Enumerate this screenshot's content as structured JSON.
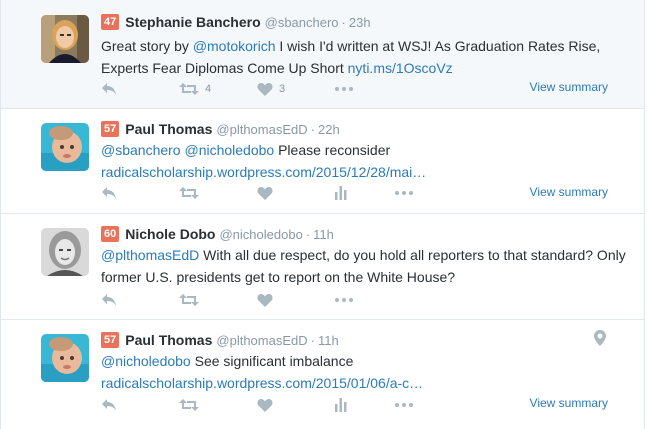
{
  "colors": {
    "link": "#2b7bb9",
    "score": "#e8735a",
    "muted": "#8899a6",
    "icon": "#aab8c2"
  },
  "tweets": [
    {
      "score": "47",
      "name": "Stephanie Banchero",
      "handle": "@sbanchero",
      "sep": "·",
      "time": "23h",
      "text_parts": {
        "a": "Great story by ",
        "b": "@motokorich",
        "c": " I wish I'd written at WSJ! As Graduation Rates Rise, Experts Fear Diplomas Come Up Short ",
        "d": "nyti.ms/1OscoVz"
      },
      "retweets": "4",
      "likes": "3",
      "summary": "View summary",
      "icons": [
        "reply-icon",
        "retweet-icon",
        "like-icon",
        "more-icon"
      ]
    },
    {
      "score": "57",
      "name": "Paul Thomas",
      "handle": "@plthomasEdD",
      "sep": "·",
      "time": "22h",
      "text_parts": {
        "a": "@sbanchero @nicholedobo",
        "b": " Please reconsider",
        "c": "radicalscholarship.wordpress.com/2015/12/28/mai…"
      },
      "summary": "View summary",
      "icons": [
        "reply-icon",
        "retweet-icon",
        "like-icon",
        "analytics-icon",
        "more-icon"
      ]
    },
    {
      "score": "60",
      "name": "Nichole Dobo",
      "handle": "@nicholedobo",
      "sep": "·",
      "time": "11h",
      "text_parts": {
        "a": "@plthomasEdD",
        "b": " With all due respect, do you hold all reporters to that standard? Only former U.S. presidents get to report on the White House?"
      },
      "icons": [
        "reply-icon",
        "retweet-icon",
        "like-icon",
        "more-icon"
      ]
    },
    {
      "score": "57",
      "name": "Paul Thomas",
      "handle": "@plthomasEdD",
      "sep": "·",
      "time": "11h",
      "text_parts": {
        "a": "@nicholedobo",
        "b": " See significant imbalance",
        "c": "radicalscholarship.wordpress.com/2015/01/06/a-c…"
      },
      "summary": "View summary",
      "icons": [
        "reply-icon",
        "retweet-icon",
        "like-icon",
        "analytics-icon",
        "more-icon",
        "location-pin-icon"
      ]
    }
  ]
}
